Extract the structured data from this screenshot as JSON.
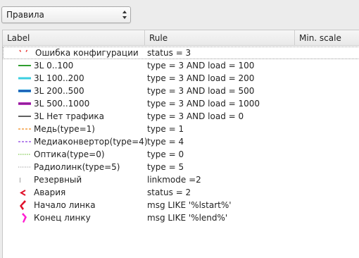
{
  "combo": {
    "value": "Правила"
  },
  "table": {
    "headers": {
      "label": "Label",
      "rule": "Rule",
      "min_scale": "Min. scale"
    },
    "rows": [
      {
        "label": "Ошибка конфигурации",
        "rule": "status = 3",
        "symbol": "red-tick-icon",
        "color": "#e8322e"
      },
      {
        "label": "3L 0..100",
        "rule": "type = 3  AND load  = 100",
        "symbol": "green-line-icon",
        "color": "#2f9e2f"
      },
      {
        "label": "3L 100..200",
        "rule": "type = 3  AND load  = 200",
        "symbol": "cyan-line-icon",
        "color": "#3ccfe0"
      },
      {
        "label": "3L 200..500",
        "rule": "type = 3  AND load  = 500",
        "symbol": "blue-line-icon",
        "color": "#1f6bd4"
      },
      {
        "label": "3L 500..1000",
        "rule": "type = 3  AND load  = 1000",
        "symbol": "magenta-line-icon",
        "color": "#c43bc4"
      },
      {
        "label": "3L Нет трафика",
        "rule": "type = 3  AND load  = 0",
        "symbol": "black-line-icon",
        "color": "#000000"
      },
      {
        "label": "Медь(type=1)",
        "rule": "type = 1",
        "symbol": "orange-dashed-line-icon",
        "color": "#f08a1c"
      },
      {
        "label": "Медиаконвертор(type=4)",
        "rule": "type = 4",
        "symbol": "purple-dashed-line-icon",
        "color": "#8a3ce0"
      },
      {
        "label": "Оптика(type=0)",
        "rule": "type = 0",
        "symbol": "lightgreen-dotted-line-icon",
        "color": "#7cc74a"
      },
      {
        "label": "Радиолинк(type=5)",
        "rule": "type = 5",
        "symbol": "gray-dotted-line-icon",
        "color": "#8c8c8c"
      },
      {
        "label": "Резервный",
        "rule": "linkmode =2",
        "symbol": "gray-tick-icon",
        "color": "#a0a0a0"
      },
      {
        "label": "Авария",
        "rule": "status  = 2",
        "symbol": "red-chevron-icon",
        "color": "#e0102a"
      },
      {
        "label": "Начало линка",
        "rule": "msg  LIKE '%lstart%'",
        "symbol": "red-start-marker-icon",
        "color": "#e0102a"
      },
      {
        "label": "Конец линку",
        "rule": "msg  LIKE '%lend%'",
        "symbol": "magenta-end-marker-icon",
        "color": "#ff1fd2"
      }
    ]
  }
}
